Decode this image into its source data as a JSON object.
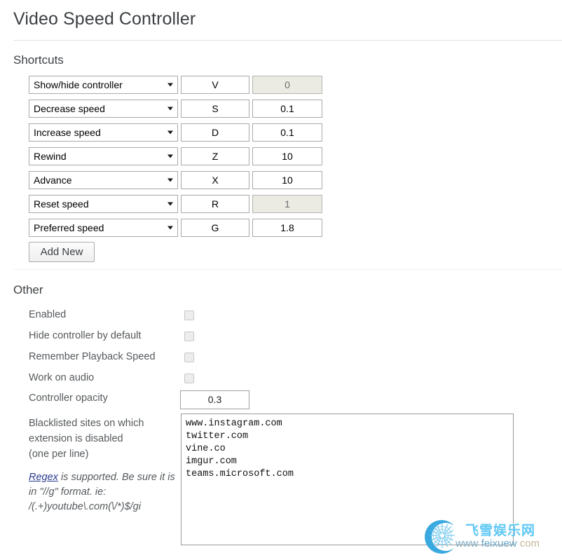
{
  "page": {
    "title": "Video Speed Controller"
  },
  "shortcuts": {
    "heading": "Shortcuts",
    "add_new_label": "Add New",
    "rows": [
      {
        "action": "Show/hide controller",
        "key": "V",
        "value": "0",
        "value_disabled": true
      },
      {
        "action": "Decrease speed",
        "key": "S",
        "value": "0.1",
        "value_disabled": false
      },
      {
        "action": "Increase speed",
        "key": "D",
        "value": "0.1",
        "value_disabled": false
      },
      {
        "action": "Rewind",
        "key": "Z",
        "value": "10",
        "value_disabled": false
      },
      {
        "action": "Advance",
        "key": "X",
        "value": "10",
        "value_disabled": false
      },
      {
        "action": "Reset speed",
        "key": "R",
        "value": "1",
        "value_disabled": true
      },
      {
        "action": "Preferred speed",
        "key": "G",
        "value": "1.8",
        "value_disabled": false
      }
    ]
  },
  "other": {
    "heading": "Other",
    "checkboxes": [
      {
        "label": "Enabled",
        "checked": false
      },
      {
        "label": "Hide controller by default",
        "checked": false
      },
      {
        "label": "Remember Playback Speed",
        "checked": false
      },
      {
        "label": "Work on audio",
        "checked": false
      }
    ],
    "opacity": {
      "label": "Controller opacity",
      "value": "0.3"
    },
    "blacklist": {
      "label": "Blacklisted sites on which extension is disabled (one per line)",
      "regex_link_text": "Regex",
      "regex_note_rest": " is supported. Be sure it is in \"//g\" format. ie: /(.+)youtube\\.com(\\/*)$/gi",
      "value": "www.instagram.com\ntwitter.com\nvine.co\nimgur.com\nteams.microsoft.com"
    }
  },
  "watermark": {
    "cn_text": "飞雪娱乐网",
    "url_www": "www",
    "url_name": "feixuew",
    "url_tld": "com"
  }
}
